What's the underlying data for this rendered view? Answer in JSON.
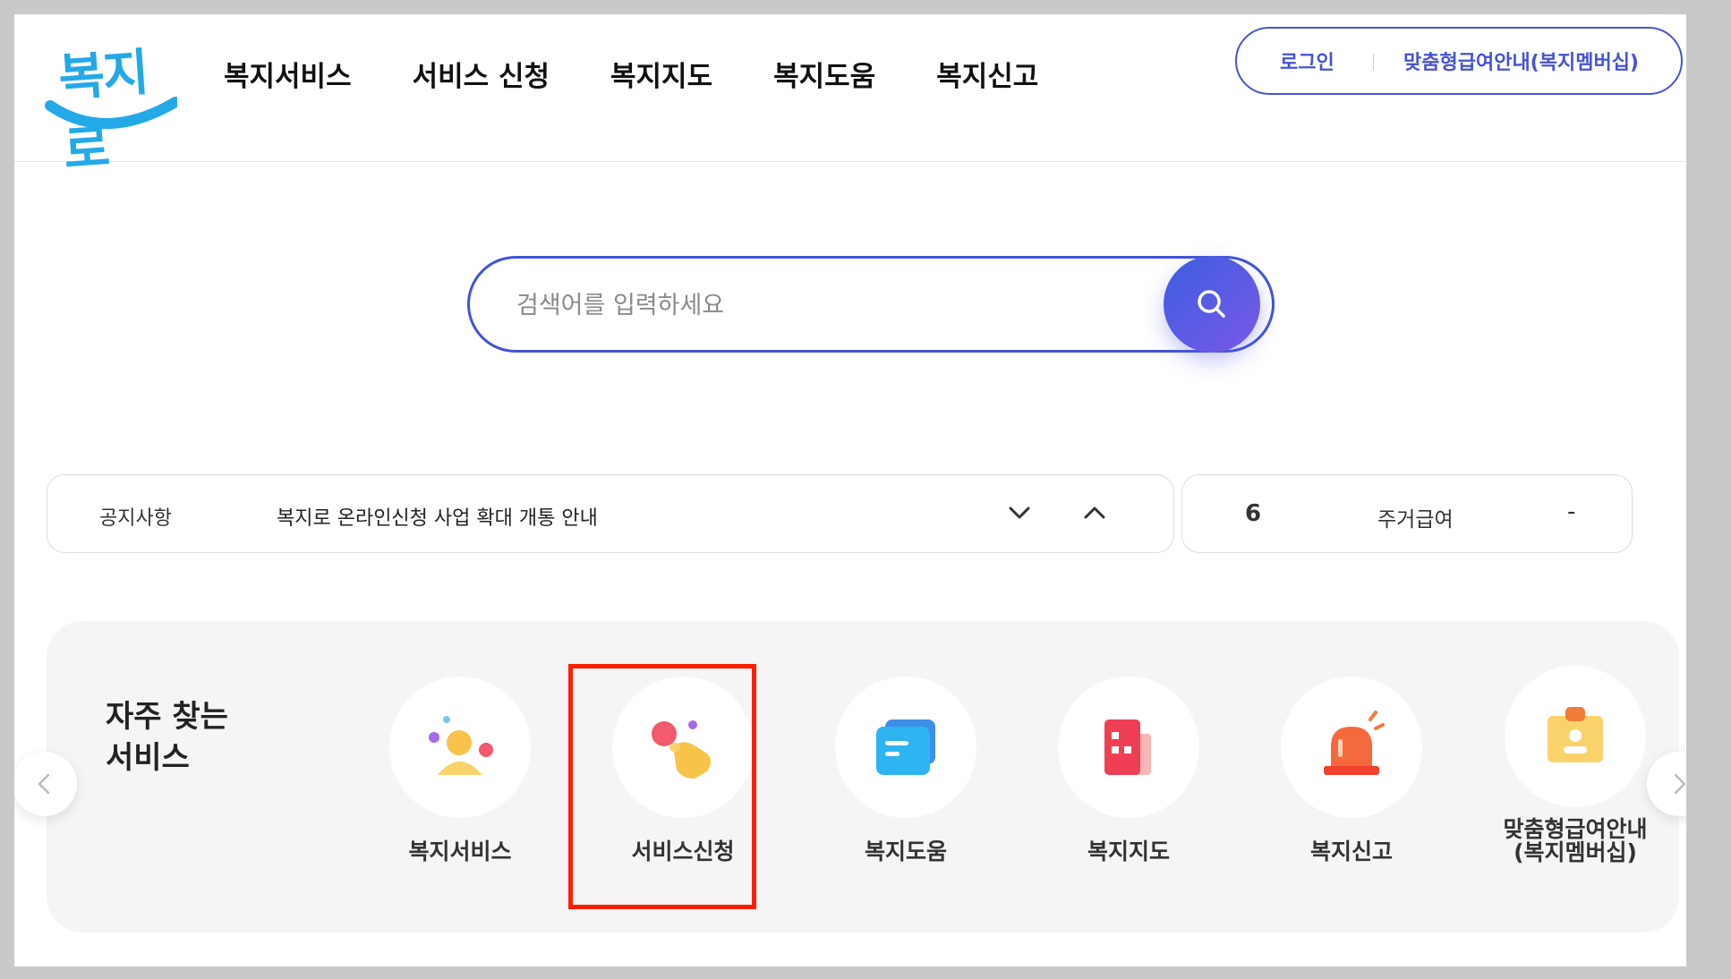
{
  "header": {
    "logo_text": "복지로",
    "nav": [
      "복지서비스",
      "서비스 신청",
      "복지지도",
      "복지도움",
      "복지신고"
    ],
    "login_label": "로그인",
    "member_label": "맞춤형급여안내(복지멤버십)"
  },
  "search": {
    "placeholder": "검색어를 입력하세요",
    "value": "",
    "button_icon": "search-icon"
  },
  "notice": {
    "label": "공지사항",
    "text": "복지로 온라인신청 사업 확대 개통 안내"
  },
  "ticker": {
    "rank": "6",
    "label": "주거급여",
    "change": "-"
  },
  "frequent": {
    "title_line1": "자주 찾는",
    "title_line2": "서비스",
    "items": [
      {
        "label": "복지서비스",
        "icon": "people-icon"
      },
      {
        "label": "서비스신청",
        "icon": "tap-hand-icon"
      },
      {
        "label": "복지도움",
        "icon": "chat-card-icon"
      },
      {
        "label": "복지지도",
        "icon": "map-building-icon"
      },
      {
        "label": "복지신고",
        "icon": "alarm-light-icon"
      },
      {
        "label_line1": "맞춤형급여안내",
        "label_line2": "(복지멤버십)",
        "icon": "id-badge-icon"
      }
    ]
  },
  "colors": {
    "accent": "#4652d6",
    "logo": "#23a9e8",
    "highlight": "#ff1e00"
  }
}
